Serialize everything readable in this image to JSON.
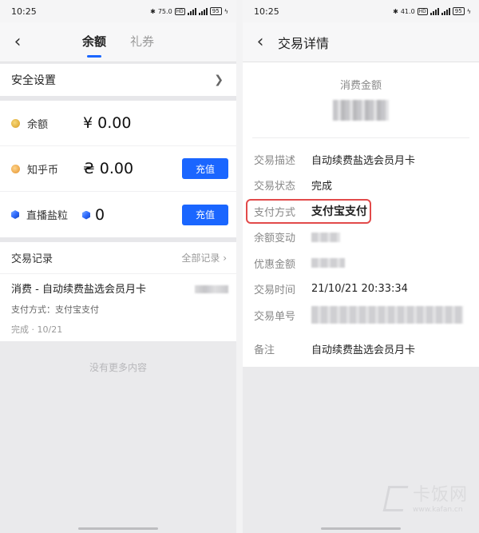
{
  "left": {
    "statusbar": {
      "time": "10:25",
      "speed": "75.0",
      "battery": "95"
    },
    "nav": {
      "back": "‹",
      "tabs": [
        {
          "label": "余额",
          "active": true
        },
        {
          "label": "礼券",
          "active": false
        }
      ]
    },
    "settings_label": "安全设置",
    "balances": [
      {
        "label": "余额",
        "value": "¥ 0.00",
        "icon": "coin-icon"
      },
      {
        "label": "知乎币",
        "value": "₴ 0.00",
        "icon": "zhihu-coin-icon",
        "button": "充值"
      },
      {
        "label": "直播盐粒",
        "value": "0",
        "icon": "salt-gem-icon",
        "button": "充值"
      }
    ],
    "records": {
      "title": "交易记录",
      "all_label": "全部记录",
      "items": [
        {
          "title": "消费 - 自动续费盐选会员月卡",
          "subtitle": "支付方式：支付宝支付",
          "status": "完成 · 10/21"
        }
      ]
    },
    "no_more": "没有更多内容"
  },
  "right": {
    "statusbar": {
      "time": "10:25",
      "speed": "41.0",
      "battery": "95"
    },
    "nav": {
      "back": "‹",
      "title": "交易详情"
    },
    "amount_label": "消费金额",
    "rows": [
      {
        "key": "交易描述",
        "value": "自动续费盐选会员月卡"
      },
      {
        "key": "交易状态",
        "value": "完成"
      },
      {
        "key": "支付方式",
        "value": "支付宝支付",
        "highlighted": true
      },
      {
        "key": "余额变动",
        "value": ""
      },
      {
        "key": "优惠金额",
        "value": ""
      },
      {
        "key": "交易时间",
        "value": "21/10/21 20:33:34"
      },
      {
        "key": "交易单号",
        "value": ""
      }
    ],
    "note": {
      "key": "备注",
      "value": "自动续费盐选会员月卡"
    }
  },
  "watermark": {
    "text": "卡饭网",
    "url": "www.kafan.cn"
  },
  "colors": {
    "accent": "#1a66ff",
    "highlight": "#e24a4a"
  }
}
